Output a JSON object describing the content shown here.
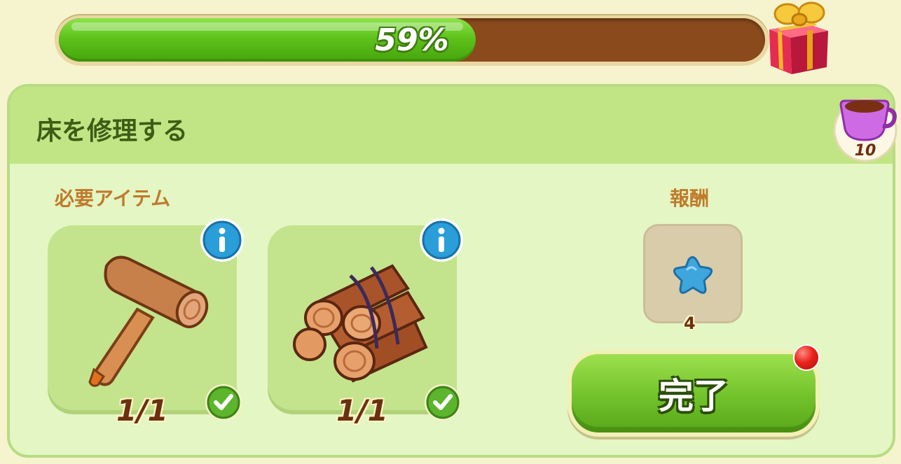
{
  "progress": {
    "percent": 0.59,
    "label": "59%"
  },
  "task": {
    "title": "床を修理する",
    "energy_cost": "10"
  },
  "required": {
    "label": "必要アイテム",
    "items": [
      {
        "name": "mallet",
        "count": "1/1",
        "complete": true
      },
      {
        "name": "wood logs",
        "count": "1/1",
        "complete": true
      }
    ]
  },
  "reward": {
    "label": "報酬",
    "icon": "blue-star",
    "amount": "4"
  },
  "done_button": {
    "label": "完了",
    "has_notification": true
  },
  "colors": {
    "progress_fill": "#5fc21b",
    "progress_track": "#8a4a1c",
    "panel_bg": "#e3f6c4",
    "header_bg": "#c1e584",
    "button_green": "#71c22a"
  }
}
